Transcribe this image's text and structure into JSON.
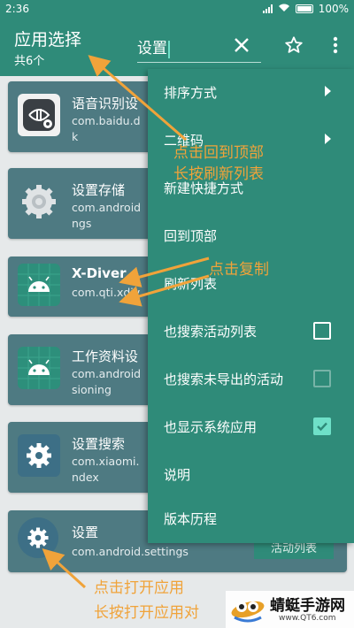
{
  "status_bar": {
    "time": "2:36",
    "battery": "100%"
  },
  "app_bar": {
    "title": "应用选择",
    "subtitle": "共6个",
    "search_value": "设置"
  },
  "apps": [
    {
      "name": "语音识别设",
      "package": "com.baidu.d",
      "package_cont": "k",
      "icon": "voice-recognition-icon"
    },
    {
      "name": "设置存储",
      "package": "com.android",
      "package_cont": "ngs",
      "icon": "gear-icon"
    },
    {
      "name": "X-Diver",
      "package": "com.qti.xdiv",
      "package_cont": "",
      "icon": "android-icon"
    },
    {
      "name": "工作资料设",
      "package": "com.android",
      "package_cont": "sioning",
      "icon": "android-icon"
    },
    {
      "name": "设置搜索",
      "package": "com.xiaomi.",
      "package_cont": "ndex",
      "icon": "gear-icon"
    },
    {
      "name": "设置",
      "package": "com.android.settings",
      "package_cont": "",
      "icon": "gear-icon"
    }
  ],
  "menu": {
    "items": [
      {
        "label": "排序方式",
        "type": "submenu"
      },
      {
        "label": "二维码",
        "type": "submenu"
      },
      {
        "label": "新建快捷方式",
        "type": "plain"
      },
      {
        "label": "回到顶部",
        "type": "plain"
      },
      {
        "label": "刷新列表",
        "type": "plain"
      },
      {
        "label": "也搜索活动列表",
        "type": "checkbox",
        "checked": false
      },
      {
        "label": "也搜索未导出的活动",
        "type": "checkbox",
        "checked": false,
        "disabled": true
      },
      {
        "label": "也显示系统应用",
        "type": "checkbox",
        "checked": true
      },
      {
        "label": "说明",
        "type": "plain"
      },
      {
        "label": "版本历程",
        "type": "plain"
      }
    ]
  },
  "activity_list_button": "活动列表",
  "annotations": {
    "scroll_top_1": "点击回到顶部",
    "scroll_top_2": "长按刷新列表",
    "copy": "点击复制",
    "open_1": "点击打开应用",
    "open_2": "长按打开应用对"
  },
  "watermark": {
    "name": "蜻蜓手游网",
    "url": "www.QT6.com"
  },
  "colors": {
    "primary": "#2f8b79",
    "card": "#4e7a82",
    "accent": "#6fe0c8",
    "annotation": "#f0a33a"
  }
}
